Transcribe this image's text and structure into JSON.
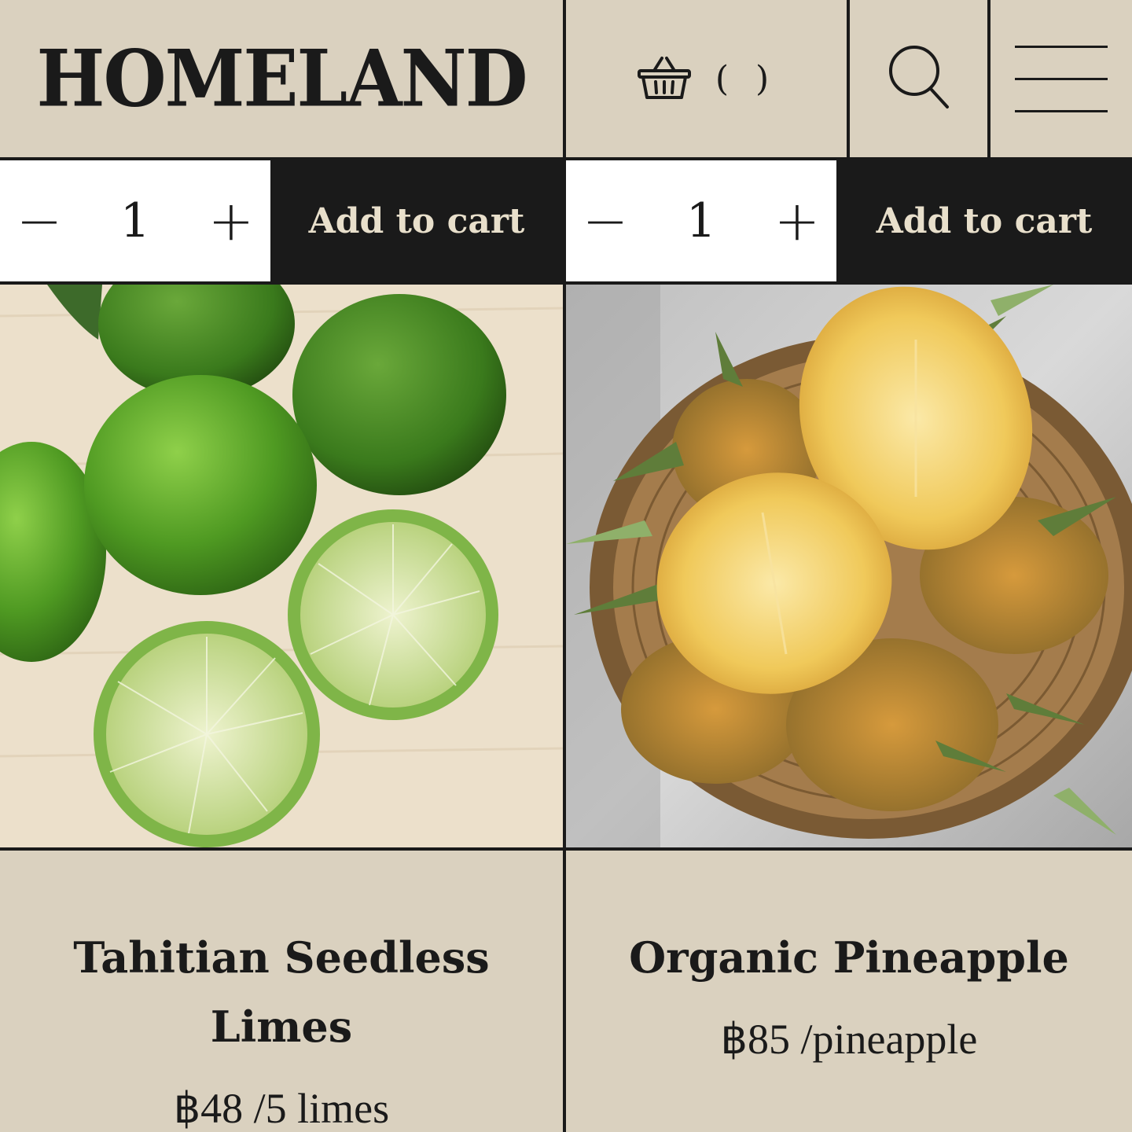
{
  "header": {
    "logo": "HOMELAND",
    "cart_count": "( )"
  },
  "products": [
    {
      "name": "Tahitian Seedless Limes",
      "price": "฿48 /5 limes",
      "quantity": "1",
      "add_label": "Add to cart",
      "minus": "−",
      "plus": "+"
    },
    {
      "name": "Organic Pineapple",
      "price": "฿85 /pineapple",
      "quantity": "1",
      "add_label": "Add to cart",
      "minus": "−",
      "plus": "+"
    }
  ],
  "colors": {
    "background": "#dad1bf",
    "ink": "#1a1a1a",
    "button_text": "#e8dfcb"
  }
}
